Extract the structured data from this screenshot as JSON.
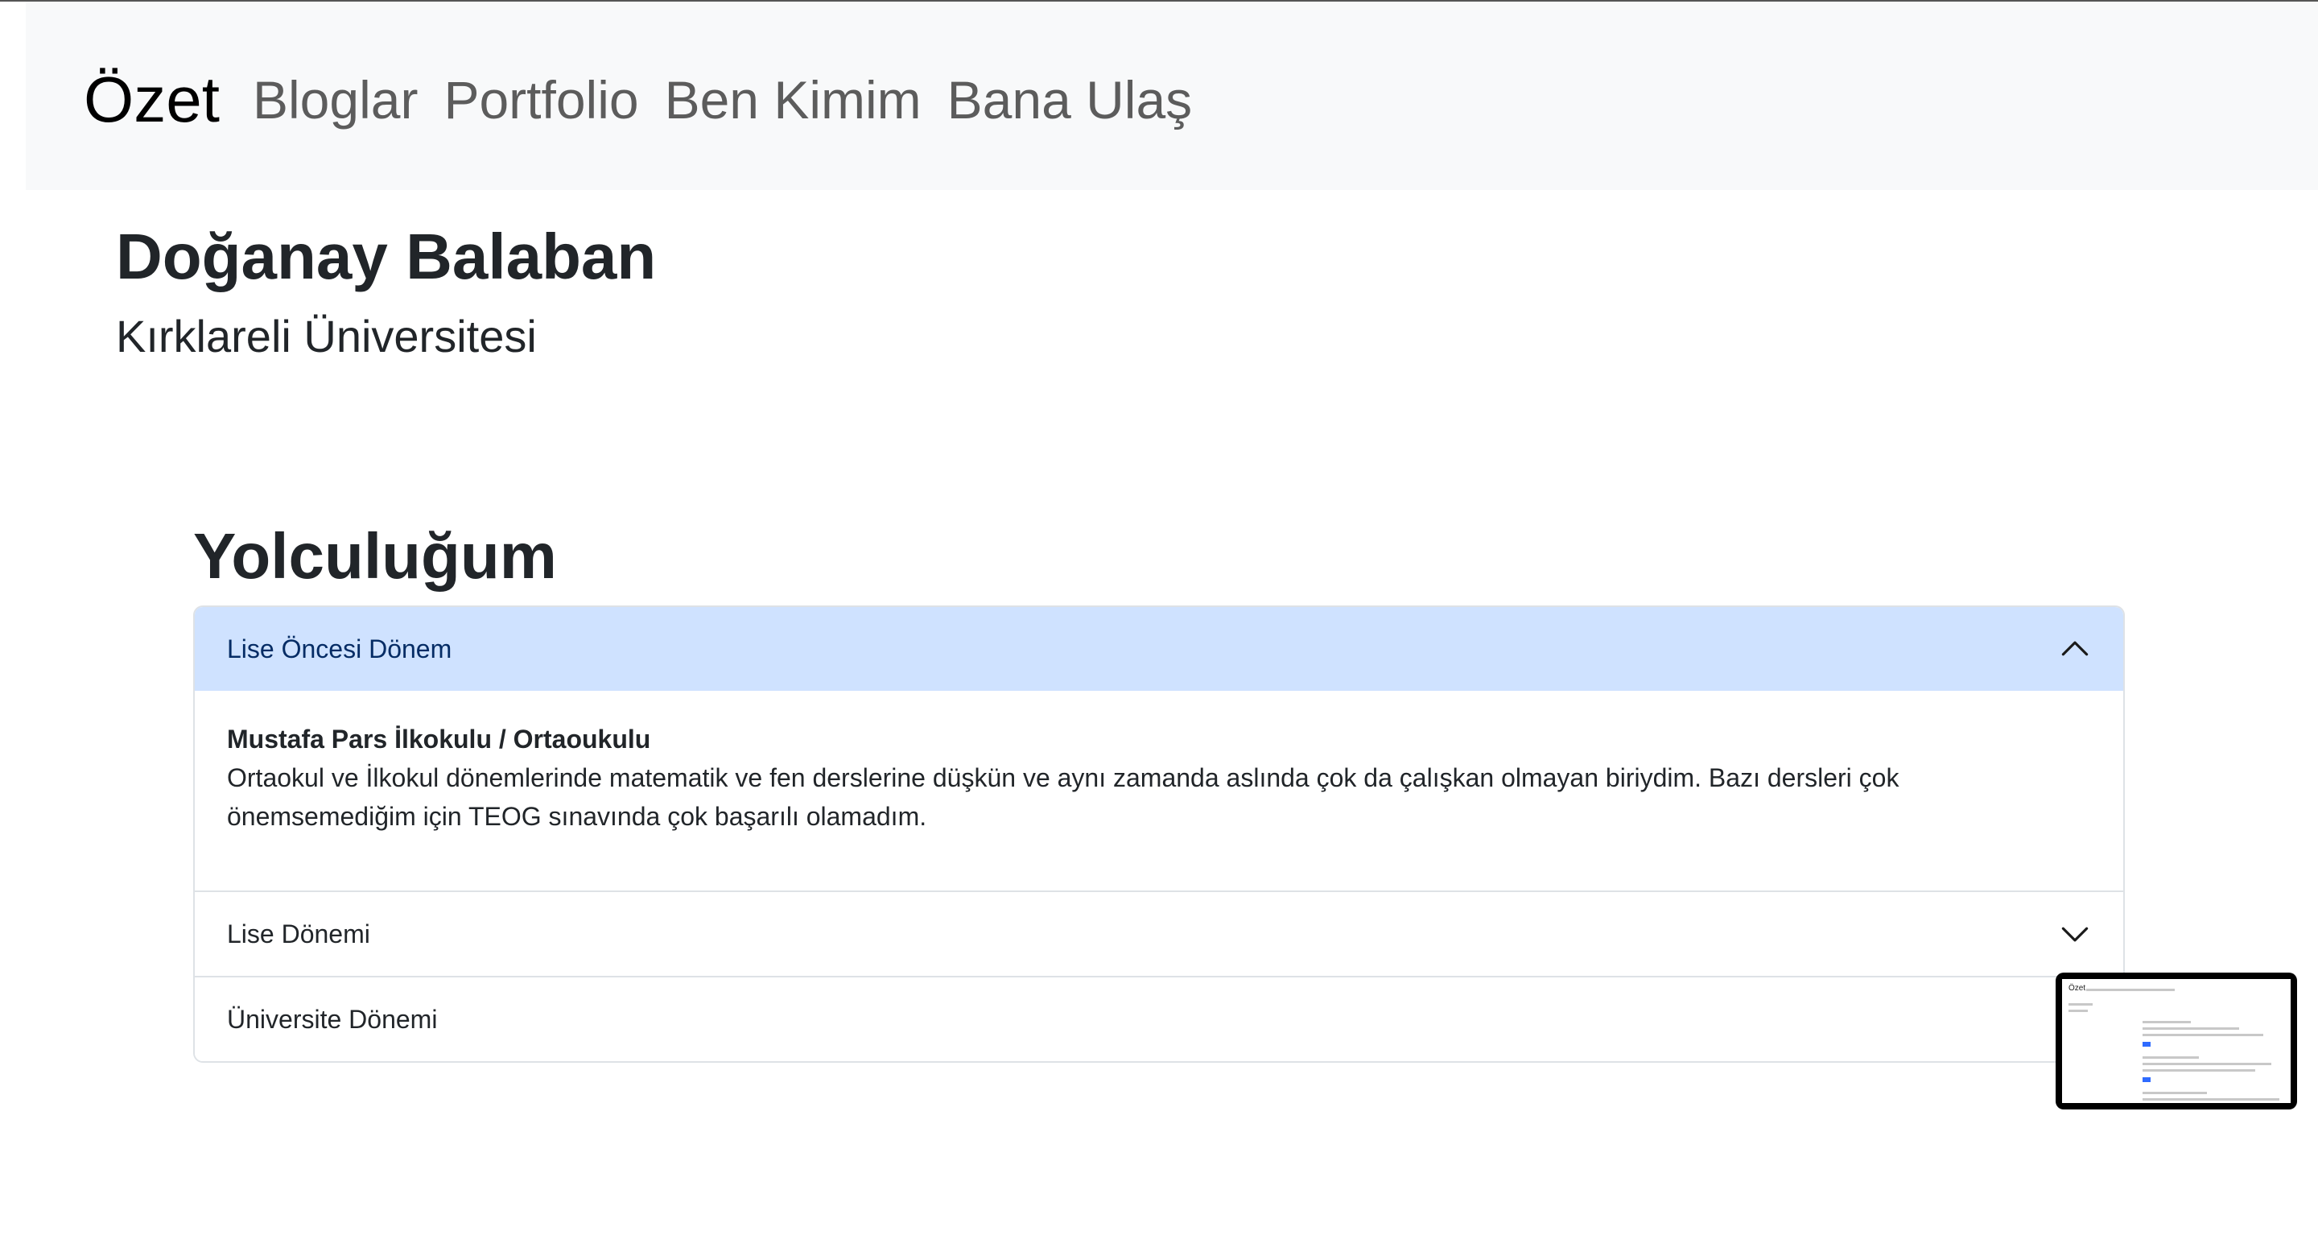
{
  "navbar": {
    "brand": "Özet",
    "links": [
      "Bloglar",
      "Portfolio",
      "Ben Kimim",
      "Bana Ulaş"
    ]
  },
  "profile": {
    "name": "Doğanay Balaban",
    "school": "Kırklareli Üniversitesi"
  },
  "journey": {
    "title": "Yolculuğum",
    "items": [
      {
        "header": "Lise Öncesi Dönem",
        "expanded": true,
        "body_title": "Mustafa Pars İlkokulu / Ortaoukulu",
        "body_text": "Ortaokul ve İlkokul dönemlerinde matematik ve fen derslerine düşkün ve aynı zamanda aslında çok da çalışkan olmayan biriydim. Bazı dersleri çok önemsemediğim için TEOG sınavında çok başarılı olamadım."
      },
      {
        "header": "Lise Dönemi",
        "expanded": false
      },
      {
        "header": "Üniversite Dönemi",
        "expanded": false
      }
    ]
  },
  "thumbnail": {
    "brand": "Özet"
  },
  "colors": {
    "navbar_bg": "#f8f9fa",
    "accordion_active_bg": "#cfe2ff",
    "accordion_active_text": "#052c65",
    "border": "#dee2e6"
  }
}
